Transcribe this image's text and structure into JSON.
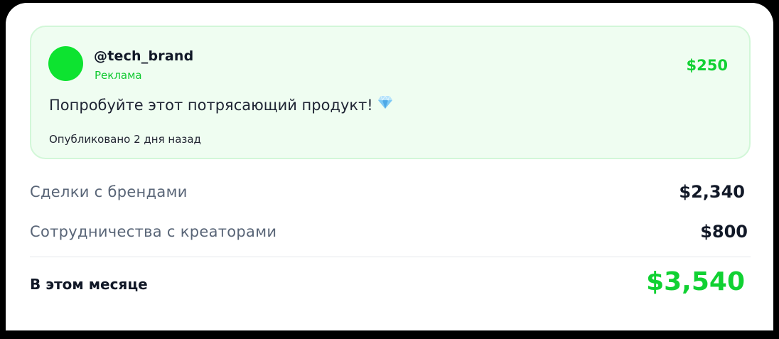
{
  "post": {
    "handle": "@tech_brand",
    "tag": "Реклама",
    "price": "$250",
    "message": "Попробуйте этот потрясающий продукт!",
    "emoji_icon": "gem-icon",
    "published": "Опубликовано 2 дня назад"
  },
  "earnings": [
    {
      "label": "Сделки с брендами",
      "value": "$2,340"
    },
    {
      "label": "Сотрудничества с креаторами",
      "value": "$800"
    }
  ],
  "total": {
    "label": "В этом месяце",
    "value": "$3,540"
  },
  "colors": {
    "accent_green": "#10d132",
    "avatar_green": "#0de330",
    "post_background": "#effdf1",
    "post_border": "#d2f7d8"
  }
}
